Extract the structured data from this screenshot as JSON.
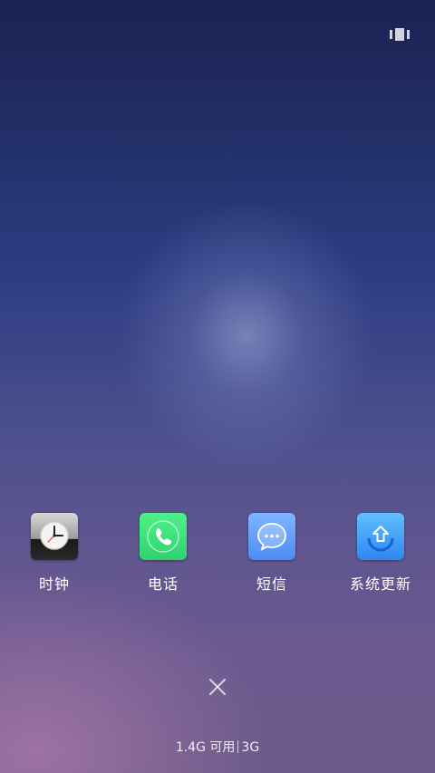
{
  "apps": [
    {
      "label": "时钟",
      "icon": "clock-icon"
    },
    {
      "label": "电话",
      "icon": "phone-icon"
    },
    {
      "label": "短信",
      "icon": "message-icon"
    },
    {
      "label": "系统更新",
      "icon": "system-update-icon"
    }
  ],
  "status": {
    "memory_available": "1.4G 可用",
    "total_memory": "3G"
  },
  "colors": {
    "phone_green": "#3ddf79",
    "sms_blue": "#5f9cfb",
    "update_blue": "#3e9cf6"
  }
}
